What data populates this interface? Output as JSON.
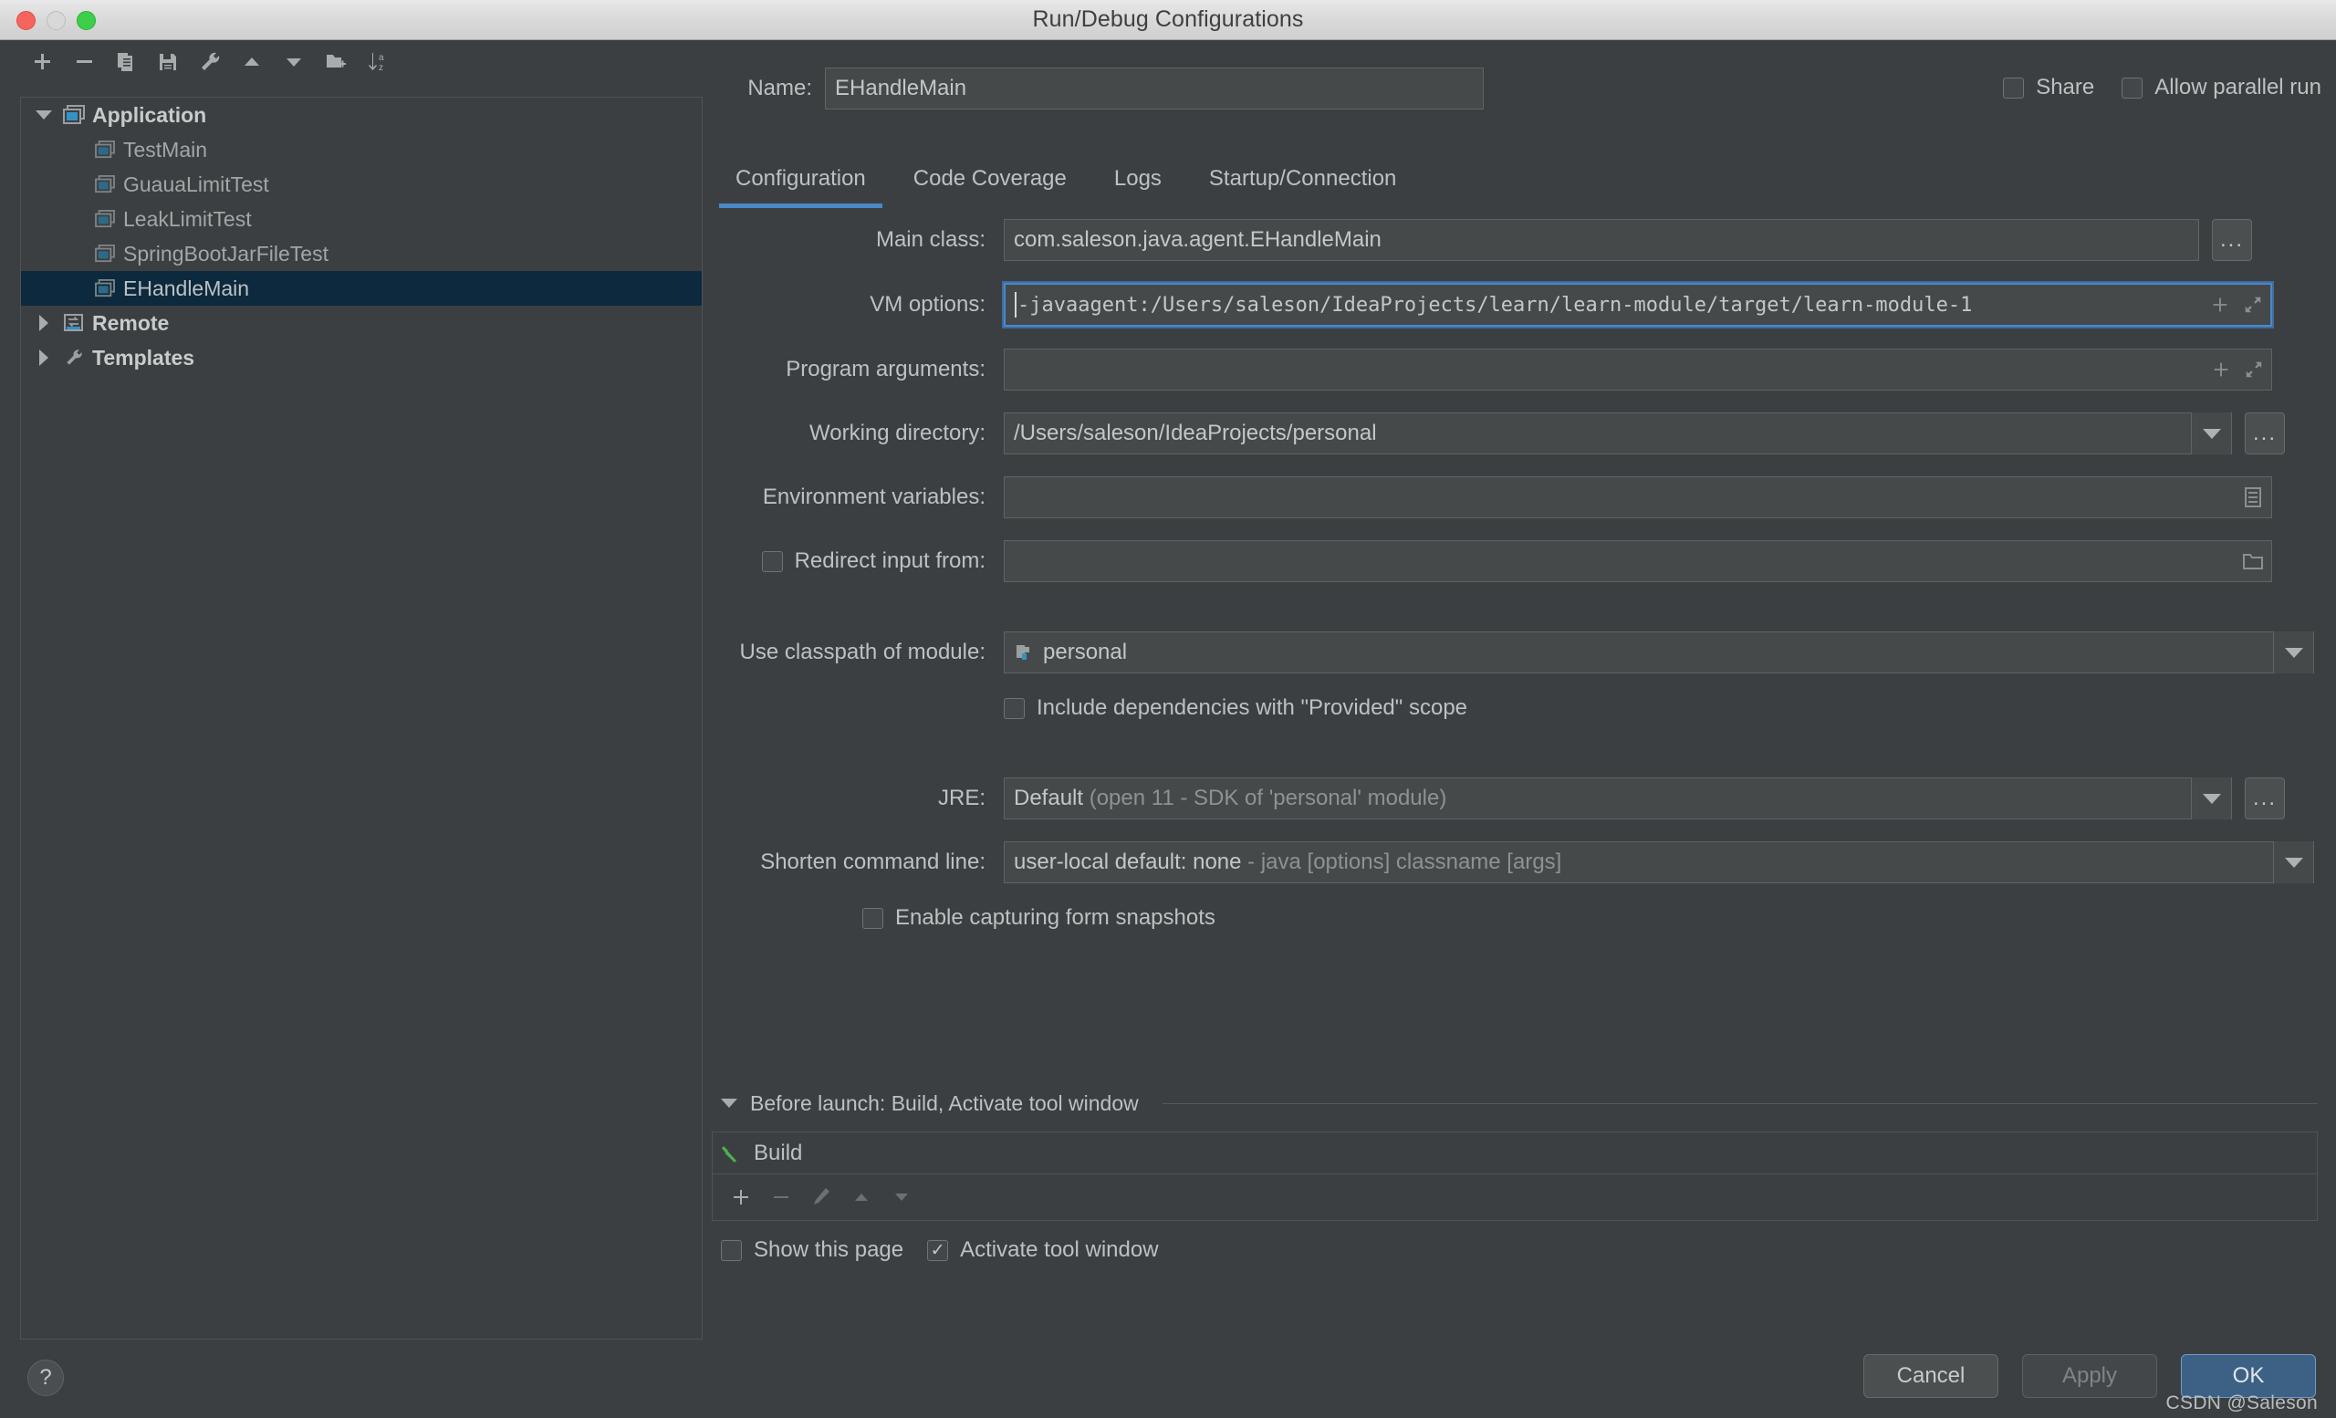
{
  "window": {
    "title": "Run/Debug Configurations",
    "traffic_lights": [
      "close",
      "minimize",
      "maximize"
    ]
  },
  "left_toolbar": {
    "items": [
      {
        "name": "add-configuration-button",
        "icon": "plus-icon"
      },
      {
        "name": "remove-configuration-button",
        "icon": "minus-icon"
      },
      {
        "name": "copy-configuration-button",
        "icon": "copy-icon"
      },
      {
        "name": "save-configuration-button",
        "icon": "save-icon"
      },
      {
        "name": "edit-templates-button",
        "icon": "wrench-icon"
      },
      {
        "name": "move-up-button",
        "icon": "arrow-up-icon"
      },
      {
        "name": "move-down-button",
        "icon": "arrow-down-icon"
      },
      {
        "name": "new-folder-button",
        "icon": "folder-add-icon"
      },
      {
        "name": "sort-configurations-button",
        "icon": "sort-az-icon"
      }
    ]
  },
  "tree": {
    "nodes": [
      {
        "label": "Application",
        "type": "group",
        "expanded": true,
        "icon": "application-icon",
        "selected": false
      },
      {
        "label": "TestMain",
        "type": "child",
        "icon": "application-icon",
        "selected": false
      },
      {
        "label": "GuauaLimitTest",
        "type": "child",
        "icon": "application-icon",
        "selected": false
      },
      {
        "label": "LeakLimitTest",
        "type": "child",
        "icon": "application-icon",
        "selected": false
      },
      {
        "label": "SpringBootJarFileTest",
        "type": "child",
        "icon": "application-icon",
        "selected": false
      },
      {
        "label": "EHandleMain",
        "type": "child",
        "icon": "application-icon",
        "selected": true
      },
      {
        "label": "Remote",
        "type": "group",
        "expanded": false,
        "icon": "remote-icon",
        "selected": false
      },
      {
        "label": "Templates",
        "type": "group",
        "expanded": false,
        "icon": "wrench-icon",
        "selected": false
      }
    ]
  },
  "header": {
    "name_label": "Name:",
    "name_value": "EHandleMain",
    "name_placeholder": "",
    "share_label": "Share",
    "share_checked": false,
    "allow_parallel_label": "Allow parallel run",
    "allow_parallel_checked": false
  },
  "tabs": [
    {
      "label": "Configuration",
      "active": true
    },
    {
      "label": "Code Coverage",
      "active": false
    },
    {
      "label": "Logs",
      "active": false
    },
    {
      "label": "Startup/Connection",
      "active": false
    }
  ],
  "form": {
    "main_class": {
      "label": "Main class:",
      "value": "com.saleson.java.agent.EHandleMain",
      "browse_label": "..."
    },
    "vm_options": {
      "label": "VM options:",
      "value": "-javaagent:/Users/saleson/IdeaProjects/learn/learn-module/target/learn-module-1",
      "focused": true,
      "insert_icon": "plus-icon",
      "expand_icon": "expand-diagonal-icon"
    },
    "program_arguments": {
      "label": "Program arguments:",
      "value": "",
      "insert_icon": "plus-icon",
      "expand_icon": "expand-diagonal-icon"
    },
    "working_directory": {
      "label": "Working directory:",
      "value": "/Users/saleson/IdeaProjects/personal",
      "browse_label": "..."
    },
    "environment_variables": {
      "label": "Environment variables:",
      "value": "",
      "trailing_icon": "list-edit-icon"
    },
    "redirect_input": {
      "label": "Redirect input from:",
      "checked": false,
      "value": "",
      "trailing_icon": "folder-icon"
    },
    "classpath_module": {
      "label": "Use classpath of module:",
      "value": "personal",
      "module_icon": "module-icon"
    },
    "include_provided": {
      "label": "Include dependencies with \"Provided\" scope",
      "checked": false
    },
    "jre": {
      "label": "JRE:",
      "value_strong": "Default",
      "value_dim": "(open 11 - SDK of 'personal' module)",
      "browse_label": "..."
    },
    "shorten_command_line": {
      "label": "Shorten command line:",
      "value_strong": "user-local default: none",
      "value_dim": "- java [options] classname [args]"
    },
    "form_snapshots": {
      "label": "Enable capturing form snapshots",
      "checked": false
    }
  },
  "before_launch": {
    "title": "Before launch: Build, Activate tool window",
    "expanded": true,
    "tasks": [
      {
        "label": "Build",
        "icon": "hammer-icon",
        "icon_color": "#4caf50"
      }
    ],
    "toolbar": [
      {
        "name": "add-task-button",
        "icon": "plus-icon",
        "enabled": true
      },
      {
        "name": "remove-task-button",
        "icon": "minus-icon",
        "enabled": false
      },
      {
        "name": "edit-task-button",
        "icon": "pencil-icon",
        "enabled": false
      },
      {
        "name": "move-task-up-button",
        "icon": "arrow-up-icon",
        "enabled": false
      },
      {
        "name": "move-task-down-button",
        "icon": "arrow-down-icon",
        "enabled": false
      }
    ],
    "show_this_page": {
      "label": "Show this page",
      "checked": false
    },
    "activate_tool_window": {
      "label": "Activate tool window",
      "checked": true
    }
  },
  "footer": {
    "help_label": "?",
    "cancel_label": "Cancel",
    "apply_label": "Apply",
    "apply_enabled": false,
    "ok_label": "OK"
  },
  "watermark": "CSDN @Saleson",
  "colors": {
    "background": "#3c3f41",
    "field_background": "#45494a",
    "accent_blue": "#4a88c7",
    "selection_blue": "#0d293e",
    "primary_button": "#3d6185",
    "build_green": "#4caf50",
    "text": "#bdc1c2",
    "text_dim": "#8e9293"
  }
}
